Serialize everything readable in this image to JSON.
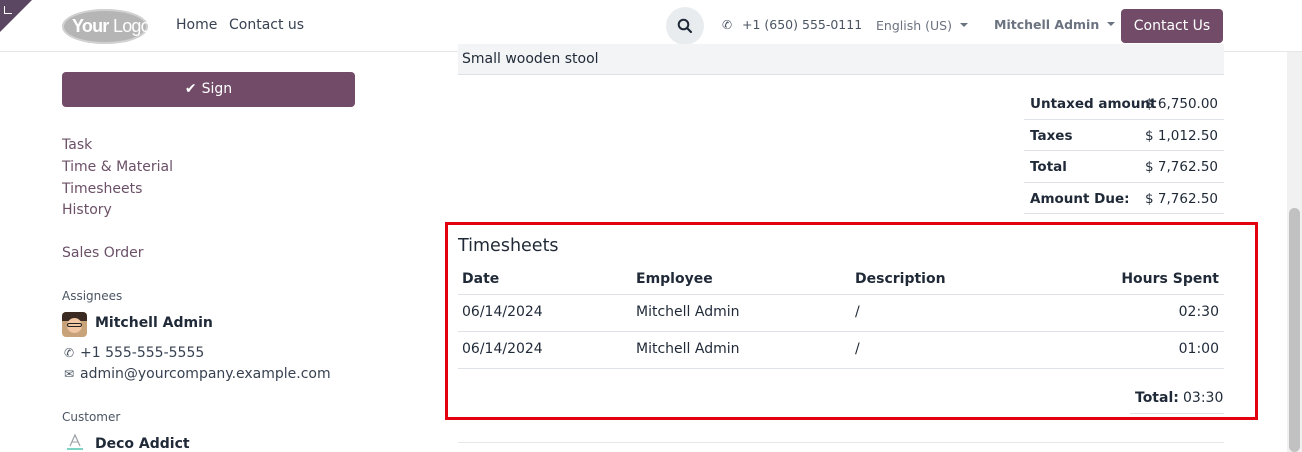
{
  "header": {
    "logo_part1": "Your",
    "logo_part2": "Logo",
    "nav": [
      "Home",
      "Contact us"
    ],
    "phone": "+1 (650) 555-0111",
    "language": "English (US)",
    "user": "Mitchell Admin",
    "contact_button": "Contact Us"
  },
  "sidebar": {
    "sign_button": "Sign",
    "links": [
      "Task",
      "Time & Material",
      "Timesheets",
      "History"
    ],
    "sales_order": "Sales Order",
    "assignees_heading": "Assignees",
    "assignee": {
      "name": "Mitchell Admin",
      "phone": "+1 555-555-5555",
      "email": "admin@yourcompany.example.com"
    },
    "customer_heading": "Customer",
    "customer_name": "Deco Addict"
  },
  "order": {
    "product_line": "Small wooden stool",
    "totals": [
      {
        "label": "Untaxed amount",
        "value": "$ 6,750.00"
      },
      {
        "label": "Taxes",
        "value": "$ 1,012.50"
      },
      {
        "label": "Total",
        "value": "$ 7,762.50"
      },
      {
        "label": "Amount Due:",
        "value": "$ 7,762.50"
      }
    ]
  },
  "timesheets": {
    "title": "Timesheets",
    "columns": [
      "Date",
      "Employee",
      "Description",
      "Hours Spent"
    ],
    "rows": [
      {
        "date": "06/14/2024",
        "employee": "Mitchell Admin",
        "description": "/",
        "hours": "02:30"
      },
      {
        "date": "06/14/2024",
        "employee": "Mitchell Admin",
        "description": "/",
        "hours": "01:00"
      }
    ],
    "total_label": "Total:",
    "total_value": "03:30"
  },
  "colors": {
    "brand": "#714b67",
    "highlight": "#e3000f"
  },
  "icons": [
    "search-icon",
    "phone-icon",
    "check-icon",
    "email-icon",
    "chevron-down-icon"
  ]
}
